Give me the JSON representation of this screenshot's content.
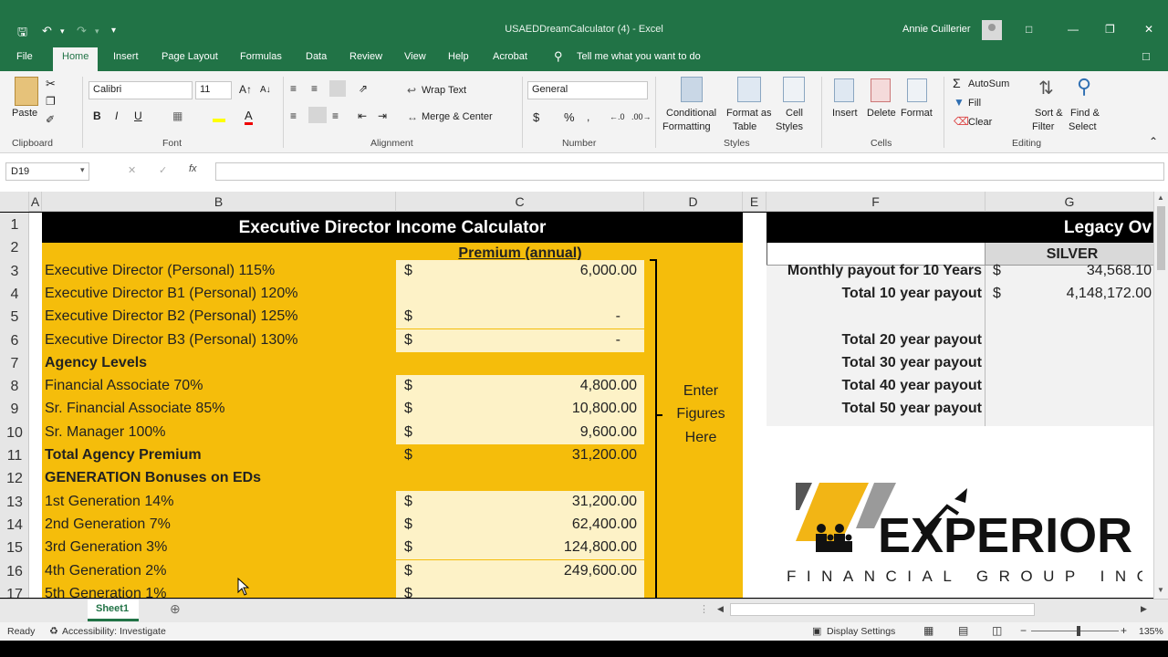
{
  "window": {
    "title": "USAEDDreamCalculator (4)  -  Excel",
    "user": "Annie Cuillerier"
  },
  "menu_tabs": [
    "File",
    "Home",
    "Insert",
    "Page Layout",
    "Formulas",
    "Data",
    "Review",
    "View",
    "Help",
    "Acrobat"
  ],
  "tell_me": "Tell me what you want to do",
  "ribbon": {
    "paste": "Paste",
    "font_name": "Calibri",
    "font_size": "11",
    "wrap_text": "Wrap Text",
    "merge_center": "Merge & Center",
    "number_format": "General",
    "conditional_formatting": [
      "Conditional",
      "Formatting"
    ],
    "format_as_table": [
      "Format as",
      "Table"
    ],
    "cell_styles": [
      "Cell",
      "Styles"
    ],
    "insert": "Insert",
    "delete": "Delete",
    "format": "Format",
    "autosum": "AutoSum",
    "fill": "Fill",
    "clear": "Clear",
    "sort_filter": [
      "Sort &",
      "Filter"
    ],
    "find_select": [
      "Find &",
      "Select"
    ],
    "groups": [
      "Clipboard",
      "Font",
      "Alignment",
      "Number",
      "Styles",
      "Cells",
      "Editing"
    ]
  },
  "formula_bar": {
    "name_box": "D19",
    "fx": "fx"
  },
  "columns": [
    "A",
    "B",
    "C",
    "D",
    "E",
    "F",
    "G"
  ],
  "rows": [
    "1",
    "2",
    "3",
    "4",
    "5",
    "6",
    "7",
    "8",
    "9",
    "10",
    "11",
    "12",
    "13",
    "14",
    "15",
    "16",
    "17"
  ],
  "sheet": {
    "title": "Executive Director Income Calculator",
    "premium_header": "Premium (annual)",
    "currency": "$",
    "lines": [
      {
        "label": "Executive Director (Personal) 115%",
        "bold": false,
        "dollar": true,
        "value": "6,000.00",
        "box": true
      },
      {
        "label": "Executive Director B1 (Personal) 120%",
        "bold": false,
        "dollar": false,
        "value": "",
        "box": true
      },
      {
        "label": "Executive Director B2 (Personal) 125%",
        "bold": false,
        "dollar": true,
        "value": "-",
        "box": true
      },
      {
        "label": "Executive Director B3 (Personal) 130%",
        "bold": false,
        "dollar": true,
        "value": "-",
        "box": true
      },
      {
        "label": "Agency Levels",
        "bold": true,
        "dollar": false,
        "value": "",
        "box": false
      },
      {
        "label": "Financial Associate 70%",
        "bold": false,
        "dollar": true,
        "value": "4,800.00",
        "box": true
      },
      {
        "label": "Sr. Financial Associate 85%",
        "bold": false,
        "dollar": true,
        "value": "10,800.00",
        "box": true
      },
      {
        "label": "Sr. Manager 100%",
        "bold": false,
        "dollar": true,
        "value": "9,600.00",
        "box": true
      },
      {
        "label": "Total Agency Premium",
        "bold": true,
        "dollar": true,
        "value": "31,200.00",
        "box": false
      },
      {
        "label": "GENERATION Bonuses on EDs",
        "bold": true,
        "dollar": false,
        "value": "",
        "box": false
      },
      {
        "label": "1st Generation 14%",
        "bold": false,
        "dollar": true,
        "value": "31,200.00",
        "box": true
      },
      {
        "label": "2nd Generation 7%",
        "bold": false,
        "dollar": true,
        "value": "62,400.00",
        "box": true
      },
      {
        "label": "3rd Generation 3%",
        "bold": false,
        "dollar": true,
        "value": "124,800.00",
        "box": true
      },
      {
        "label": "4th Generation 2%",
        "bold": false,
        "dollar": true,
        "value": "249,600.00",
        "box": true
      },
      {
        "label": "5th Generation 1%",
        "bold": false,
        "dollar": true,
        "value": "",
        "box": true
      }
    ],
    "enter_note": [
      "Enter",
      "Figures",
      "Here"
    ],
    "legacy_title": "Legacy Ov",
    "silver": "SILVER",
    "payouts": [
      {
        "label": "Monthly payout for 10 Years",
        "dollar": "$",
        "value": "34,568.10"
      },
      {
        "label": "Total 10 year payout",
        "dollar": "$",
        "value": "4,148,172.00"
      },
      {
        "label": "",
        "dollar": "",
        "value": ""
      },
      {
        "label": "Total 20 year payout",
        "dollar": "",
        "value": ""
      },
      {
        "label": "Total 30 year payout",
        "dollar": "",
        "value": ""
      },
      {
        "label": "Total 40 year payout",
        "dollar": "",
        "value": ""
      },
      {
        "label": "Total 50 year payout",
        "dollar": "",
        "value": ""
      }
    ],
    "logo_word": "EXPERIOR",
    "logo_sub": "FINANCIAL GROUP INC"
  },
  "sheet_tab": "Sheet1",
  "status": {
    "ready": "Ready",
    "accessibility": "Accessibility: Investigate",
    "display_settings": "Display Settings",
    "zoom": "135%"
  },
  "colors": {
    "excel_green": "#217346",
    "sheet_gold": "#f5bd0b",
    "cell_cream": "#fdf2c7",
    "title_black": "#000000",
    "gray_header": "#d9d9d9"
  }
}
